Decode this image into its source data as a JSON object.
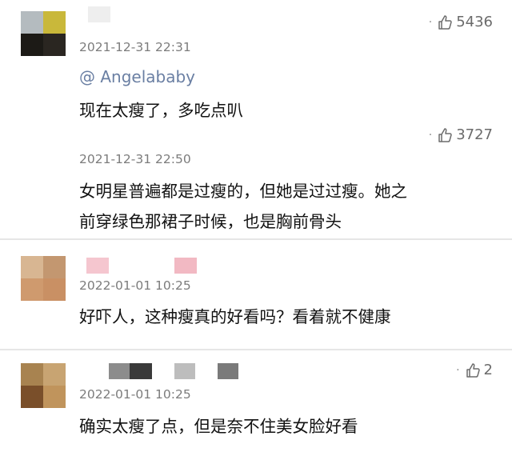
{
  "comments": [
    {
      "time": "2021-12-31 22:31",
      "likes": "5436",
      "mention": "@ Angelababy",
      "text_lines": [
        "现在太瘦了，多吃点叭"
      ],
      "avatar_colors": [
        "#b4bbbf",
        "#c9b83a",
        "#1c1a16",
        "#2a2621"
      ],
      "name_colors": [
        "#eeeeee"
      ]
    },
    {
      "time": "2021-12-31 22:50",
      "likes": "3727",
      "text_lines": [
        "女明星普遍都是过瘦的，但她是过过瘦。她之",
        "前穿绿色那裙子时候，也是胸前骨头"
      ]
    },
    {
      "time": "2022-01-01 10:25",
      "text_lines": [
        "好吓人，这种瘦真的好看吗？看着就不健康"
      ],
      "avatar_colors": [
        "#d8b692",
        "#c39770",
        "#cf9a6e",
        "#c99064"
      ],
      "name_colors": [
        "#f5c6cf",
        "#f2b9c3"
      ]
    },
    {
      "time": "2022-01-01 10:25",
      "likes": "2",
      "text_lines": [
        "确实太瘦了点，但是奈不住美女脸好看"
      ],
      "avatar_colors": [
        "#a88350",
        "#c8a472",
        "#7a4f2a",
        "#c0945c"
      ],
      "name_colors": [
        "#8c8c8c",
        "#3a3a3a",
        "#bdbdbd",
        "#7a7a7a"
      ]
    }
  ]
}
